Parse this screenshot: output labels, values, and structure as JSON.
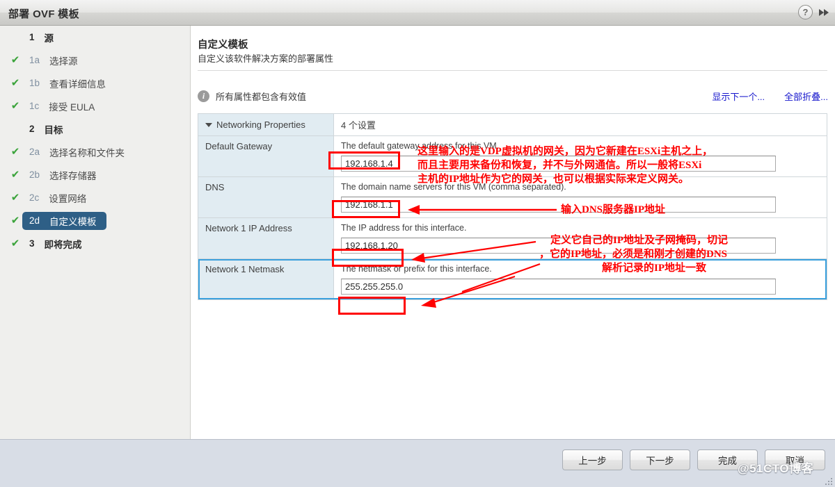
{
  "window": {
    "title": "部署 OVF 模板",
    "help_icon": "help-circle-icon",
    "collapse_icon": "double-chevron-right-icon"
  },
  "sidebar": {
    "items": [
      {
        "num": "1",
        "label": "源",
        "checked": false,
        "group": true,
        "selected": false
      },
      {
        "num": "1a",
        "label": "选择源",
        "checked": true,
        "group": false,
        "selected": false
      },
      {
        "num": "1b",
        "label": "查看详细信息",
        "checked": true,
        "group": false,
        "selected": false
      },
      {
        "num": "1c",
        "label": "接受 EULA",
        "checked": true,
        "group": false,
        "selected": false
      },
      {
        "num": "2",
        "label": "目标",
        "checked": false,
        "group": true,
        "selected": false
      },
      {
        "num": "2a",
        "label": "选择名称和文件夹",
        "checked": true,
        "group": false,
        "selected": false
      },
      {
        "num": "2b",
        "label": "选择存储器",
        "checked": true,
        "group": false,
        "selected": false
      },
      {
        "num": "2c",
        "label": "设置网络",
        "checked": true,
        "group": false,
        "selected": false
      },
      {
        "num": "2d",
        "label": "自定义模板",
        "checked": true,
        "group": false,
        "selected": true
      },
      {
        "num": "3",
        "label": "即将完成",
        "checked": true,
        "group": true,
        "selected": false
      }
    ],
    "check_glyph": "✔"
  },
  "main": {
    "title": "自定义模板",
    "subtitle": "自定义该软件解决方案的部署属性",
    "info_icon": "info-icon",
    "info_text": "所有属性都包含有效值",
    "links": [
      {
        "label": "显示下一个..."
      },
      {
        "label": "全部折叠..."
      }
    ],
    "table": {
      "group_name": "Networking Properties",
      "group_summary": "4 个设置",
      "caret_icon": "caret-down-icon",
      "rows": [
        {
          "name": "Default Gateway",
          "description": "The default gateway address for this VM.",
          "value": "192.168.1.4",
          "focused": false
        },
        {
          "name": "DNS",
          "description": "The domain name servers for this VM (comma separated).",
          "value": "192.168.1.1",
          "focused": false
        },
        {
          "name": "Network 1 IP Address",
          "description": "The IP address for this interface.",
          "value": "192.168.1.20",
          "focused": false
        },
        {
          "name": "Network 1 Netmask",
          "description": "The netmask or prefix for this interface.",
          "value": "255.255.255.0",
          "focused": true
        }
      ]
    }
  },
  "footer": {
    "buttons": [
      {
        "label": "上一步"
      },
      {
        "label": "下一步"
      },
      {
        "label": "完成"
      },
      {
        "label": "取消"
      }
    ]
  },
  "annotations": {
    "gateway_note_line1": "这里输入的是VDP虚拟机的网关，因为它新建在ESXi主机之上，",
    "gateway_note_line2": "而且主要用来备份和恢复，并不与外网通信。所以一般将ESXi",
    "gateway_note_line3": "主机的IP地址作为它的网关，也可以根据实际来定义网关。",
    "dns_note": "输入DNS服务器IP地址",
    "ip_note_line1": "定义它自己的IP地址及子网掩码，切记",
    "ip_note_line2": "，它的IP地址，必须是和刚才创建的DNS",
    "ip_note_line3": "解析记录的IP地址一致",
    "watermark": "@51CTO博客",
    "color": "#ff0000"
  }
}
